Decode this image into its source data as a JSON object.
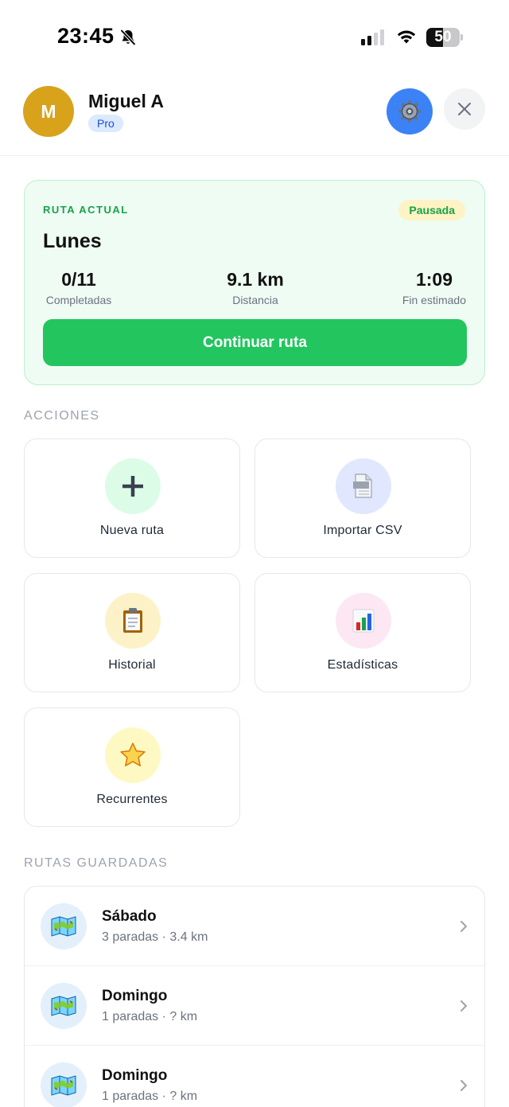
{
  "status_bar": {
    "time": "23:45",
    "battery_level": "50",
    "icons": [
      "bell-slash-icon",
      "cellular-signal-icon",
      "wifi-icon",
      "battery-icon"
    ]
  },
  "header": {
    "avatar_initial": "M",
    "user_name": "Miguel A",
    "plan_badge": "Pro",
    "settings_icon": "gear-icon",
    "close_icon": "close-icon"
  },
  "current_route": {
    "eyebrow": "RUTA ACTUAL",
    "status": "Pausada",
    "name": "Lunes",
    "stats": [
      {
        "value": "0/11",
        "label": "Completadas"
      },
      {
        "value": "9.1 km",
        "label": "Distancia"
      },
      {
        "value": "1:09",
        "label": "Fin estimado"
      }
    ],
    "continue_label": "Continuar ruta"
  },
  "actions": {
    "title": "ACCIONES",
    "items": [
      {
        "label": "Nueva ruta",
        "icon": "plus-icon",
        "color": "#dcfce7"
      },
      {
        "label": "Importar CSV",
        "icon": "document-icon",
        "color": "#e0e7ff"
      },
      {
        "label": "Historial",
        "icon": "clipboard-icon",
        "color": "#fdf1c7"
      },
      {
        "label": "Estadísticas",
        "icon": "bar-chart-icon",
        "color": "#fce7f3"
      },
      {
        "label": "Recurrentes",
        "icon": "star-icon",
        "color": "#fef9c3"
      }
    ]
  },
  "saved_routes": {
    "title": "RUTAS GUARDADAS",
    "items": [
      {
        "name": "Sábado",
        "details": "3 paradas · 3.4 km",
        "icon": "map-icon"
      },
      {
        "name": "Domingo",
        "details": "1 paradas · ? km",
        "icon": "map-icon"
      },
      {
        "name": "Domingo",
        "details": "1 paradas · ? km",
        "icon": "map-icon"
      }
    ]
  },
  "colors": {
    "accent_green": "#22c55e",
    "settings_blue": "#3b82f6",
    "avatar": "#d9a21b"
  }
}
